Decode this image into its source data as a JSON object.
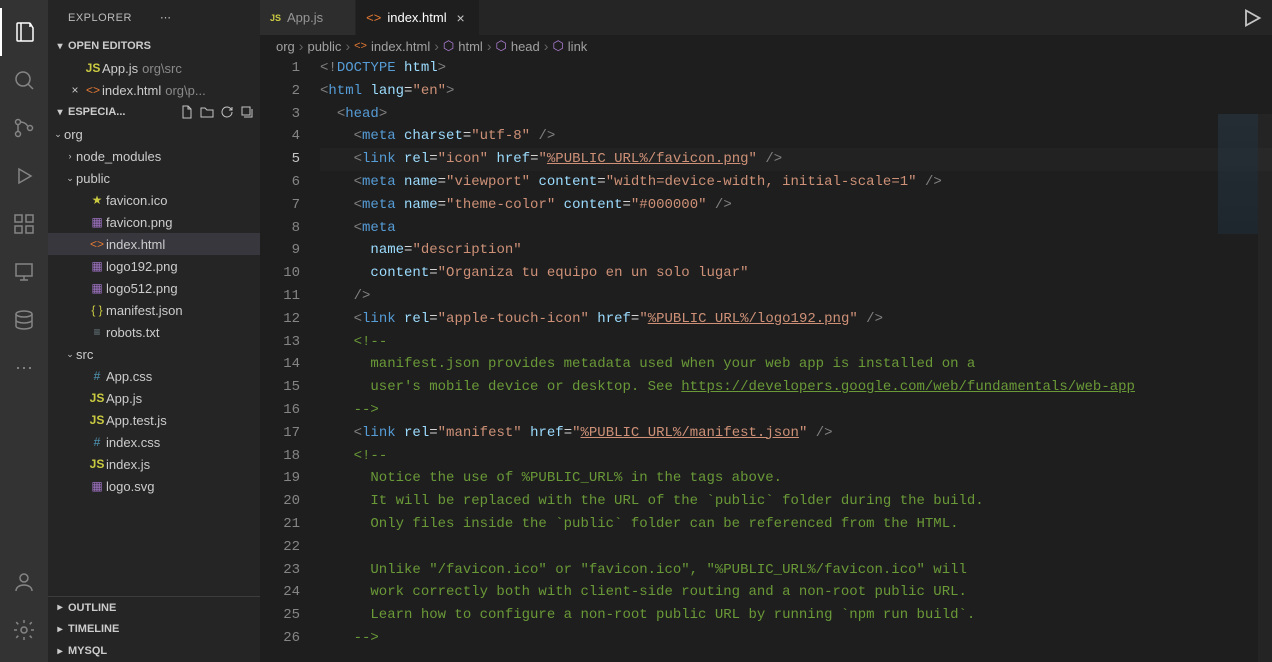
{
  "explorer": {
    "title": "EXPLORER",
    "openEditors": {
      "title": "OPEN EDITORS",
      "items": [
        {
          "icon": "js",
          "label": "App.js",
          "desc": "org\\src",
          "close": false
        },
        {
          "icon": "html",
          "label": "index.html",
          "desc": "org\\p...",
          "close": true
        }
      ]
    },
    "workspace": {
      "title": "ESPECIA...",
      "root": "org",
      "folders": [
        {
          "name": "node_modules",
          "expanded": false,
          "depth": 1
        },
        {
          "name": "public",
          "expanded": true,
          "depth": 1
        },
        {
          "name": "src",
          "expanded": true,
          "depth": 1
        }
      ],
      "publicFiles": [
        {
          "icon": "star",
          "label": "favicon.ico"
        },
        {
          "icon": "img",
          "label": "favicon.png"
        },
        {
          "icon": "html",
          "label": "index.html",
          "selected": true
        },
        {
          "icon": "img",
          "label": "logo192.png"
        },
        {
          "icon": "img",
          "label": "logo512.png"
        },
        {
          "icon": "json",
          "label": "manifest.json"
        },
        {
          "icon": "txt",
          "label": "robots.txt"
        }
      ],
      "srcFiles": [
        {
          "icon": "css",
          "label": "App.css"
        },
        {
          "icon": "js",
          "label": "App.js"
        },
        {
          "icon": "js",
          "label": "App.test.js"
        },
        {
          "icon": "css",
          "label": "index.css"
        },
        {
          "icon": "js",
          "label": "index.js"
        },
        {
          "icon": "img",
          "label": "logo.svg"
        }
      ]
    },
    "panels": {
      "outline": "OUTLINE",
      "timeline": "TIMELINE",
      "mysql": "MYSQL"
    }
  },
  "tabs": [
    {
      "icon": "js",
      "label": "App.js",
      "active": false
    },
    {
      "icon": "html",
      "label": "index.html",
      "active": true
    }
  ],
  "breadcrumbs": [
    "org",
    "public",
    "index.html",
    "html",
    "head",
    "link"
  ],
  "code": {
    "currentLine": 5,
    "lines": [
      {
        "n": 1,
        "html": "<span class='t-gray'>&lt;!</span><span class='t-blue'>DOCTYPE</span> <span class='t-lblue'>html</span><span class='t-gray'>&gt;</span>"
      },
      {
        "n": 2,
        "html": "<span class='t-gray'>&lt;</span><span class='t-blue'>html</span> <span class='t-lblue'>lang</span><span class='t-white'>=</span><span class='t-str'>\"en\"</span><span class='t-gray'>&gt;</span>"
      },
      {
        "n": 3,
        "html": "  <span class='t-gray'>&lt;</span><span class='t-blue'>head</span><span class='t-gray'>&gt;</span>"
      },
      {
        "n": 4,
        "html": "    <span class='t-gray'>&lt;</span><span class='t-blue'>meta</span> <span class='t-lblue'>charset</span><span class='t-white'>=</span><span class='t-str'>\"utf-8\"</span> <span class='t-gray'>/&gt;</span>"
      },
      {
        "n": 5,
        "html": "    <span class='t-gray'>&lt;</span><span class='t-blue'>link</span> <span class='t-lblue'>rel</span><span class='t-white'>=</span><span class='t-str'>\"icon\"</span> <span class='t-lblue'>href</span><span class='t-white'>=</span><span class='t-str'>\"<span class='underline'>%PUBLIC_URL%/favicon.png</span>\"</span> <span class='t-gray'>/&gt;</span>"
      },
      {
        "n": 6,
        "html": "    <span class='t-gray'>&lt;</span><span class='t-blue'>meta</span> <span class='t-lblue'>name</span><span class='t-white'>=</span><span class='t-str'>\"viewport\"</span> <span class='t-lblue'>content</span><span class='t-white'>=</span><span class='t-str'>\"width=device-width, initial-scale=1\"</span> <span class='t-gray'>/&gt;</span>"
      },
      {
        "n": 7,
        "html": "    <span class='t-gray'>&lt;</span><span class='t-blue'>meta</span> <span class='t-lblue'>name</span><span class='t-white'>=</span><span class='t-str'>\"theme-color\"</span> <span class='t-lblue'>content</span><span class='t-white'>=</span><span class='t-str'>\"#000000\"</span> <span class='t-gray'>/&gt;</span>"
      },
      {
        "n": 8,
        "html": "    <span class='t-gray'>&lt;</span><span class='t-blue'>meta</span>"
      },
      {
        "n": 9,
        "html": "      <span class='t-lblue'>name</span><span class='t-white'>=</span><span class='t-str'>\"description\"</span>"
      },
      {
        "n": 10,
        "html": "      <span class='t-lblue'>content</span><span class='t-white'>=</span><span class='t-str'>\"Organiza tu equipo en un solo lugar\"</span>"
      },
      {
        "n": 11,
        "html": "    <span class='t-gray'>/&gt;</span>"
      },
      {
        "n": 12,
        "html": "    <span class='t-gray'>&lt;</span><span class='t-blue'>link</span> <span class='t-lblue'>rel</span><span class='t-white'>=</span><span class='t-str'>\"apple-touch-icon\"</span> <span class='t-lblue'>href</span><span class='t-white'>=</span><span class='t-str'>\"<span class='underline'>%PUBLIC_URL%/logo192.png</span>\"</span> <span class='t-gray'>/&gt;</span>"
      },
      {
        "n": 13,
        "html": "    <span class='t-green'>&lt;!--</span>"
      },
      {
        "n": 14,
        "html": "<span class='t-green'>      manifest.json provides metadata used when your web app is installed on a</span>"
      },
      {
        "n": 15,
        "html": "<span class='t-green'>      user's mobile device or desktop. See </span><span class='t-link'>https://developers.google.com/web/fundamentals/web-app</span>"
      },
      {
        "n": 16,
        "html": "    <span class='t-green'>--&gt;</span>"
      },
      {
        "n": 17,
        "html": "    <span class='t-gray'>&lt;</span><span class='t-blue'>link</span> <span class='t-lblue'>rel</span><span class='t-white'>=</span><span class='t-str'>\"manifest\"</span> <span class='t-lblue'>href</span><span class='t-white'>=</span><span class='t-str'>\"<span class='underline'>%PUBLIC_URL%/manifest.json</span>\"</span> <span class='t-gray'>/&gt;</span>"
      },
      {
        "n": 18,
        "html": "    <span class='t-green'>&lt;!--</span>"
      },
      {
        "n": 19,
        "html": "<span class='t-green'>      Notice the use of %PUBLIC_URL% in the tags above.</span>"
      },
      {
        "n": 20,
        "html": "<span class='t-green'>      It will be replaced with the URL of the `public` folder during the build.</span>"
      },
      {
        "n": 21,
        "html": "<span class='t-green'>      Only files inside the `public` folder can be referenced from the HTML.</span>"
      },
      {
        "n": 22,
        "html": ""
      },
      {
        "n": 23,
        "html": "<span class='t-green'>      Unlike \"/favicon.ico\" or \"favicon.ico\", \"%PUBLIC_URL%/favicon.ico\" will</span>"
      },
      {
        "n": 24,
        "html": "<span class='t-green'>      work correctly both with client-side routing and a non-root public URL.</span>"
      },
      {
        "n": 25,
        "html": "<span class='t-green'>      Learn how to configure a non-root public URL by running `npm run build`.</span>"
      },
      {
        "n": 26,
        "html": "    <span class='t-green'>--&gt;</span>"
      }
    ]
  }
}
